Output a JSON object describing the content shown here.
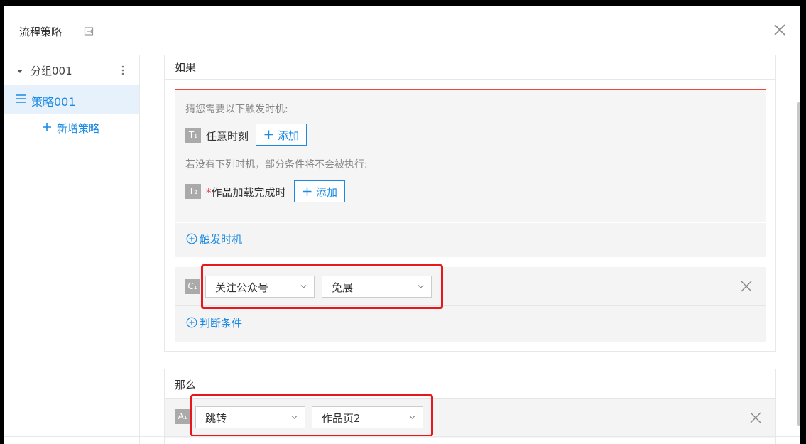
{
  "dialog": {
    "title": "流程策略",
    "close_icon": "close-icon",
    "header_icon": "export-icon"
  },
  "sidebar": {
    "group": {
      "label": "分组001",
      "expand_icon": "caret-down-icon",
      "more_icon": "more-vertical-icon"
    },
    "strategy": {
      "label": "策略001",
      "icon": "menu-icon"
    },
    "add_strategy": {
      "label": "新增策略",
      "icon": "plus-icon"
    }
  },
  "if_section": {
    "title": "如果",
    "hint_guess": "猜您需要以下触发时机:",
    "trigger1": {
      "badge": "T₁",
      "label": "任意时刻",
      "add_label": "添加"
    },
    "hint_missing": "若没有下列时机，部分条件将不会被执行:",
    "trigger2": {
      "badge": "T₂",
      "required_mark": "*",
      "label": "作品加载完成时",
      "add_label": "添加"
    },
    "add_trigger_label": "触发时机",
    "condition": {
      "badge": "C₁",
      "select1_value": "关注公众号",
      "select2_value": "免展"
    },
    "add_condition_label": "判断条件"
  },
  "then_section": {
    "title": "那么",
    "action": {
      "badge": "A₁",
      "select1_value": "跳转",
      "select2_value": "作品页2"
    }
  },
  "colors": {
    "accent": "#1a8ae5",
    "highlight": "#e8171c",
    "error_border": "#e44"
  }
}
